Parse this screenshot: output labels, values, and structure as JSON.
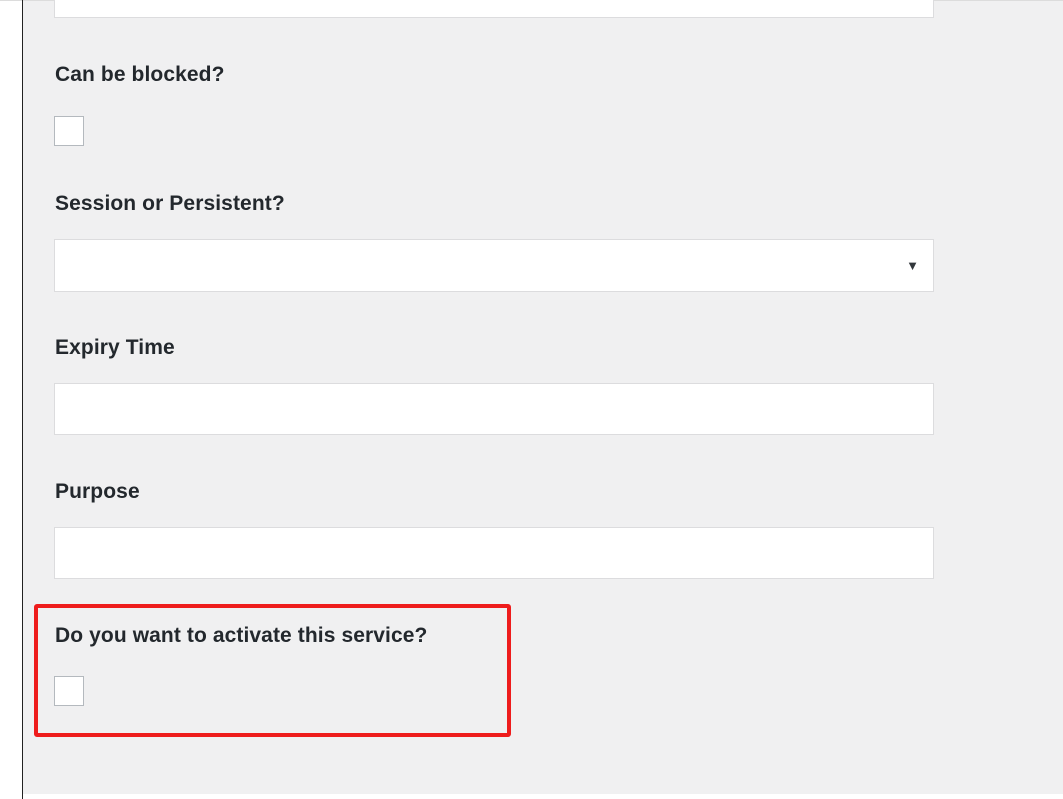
{
  "form": {
    "can_be_blocked": {
      "label": "Can be blocked?",
      "checked": false
    },
    "session_or_persistent": {
      "label": "Session or Persistent?",
      "selected_value": "",
      "arrow_icon": "dropdown-arrow-icon",
      "arrow_glyph": "▼"
    },
    "expiry_time": {
      "label": "Expiry Time",
      "value": ""
    },
    "purpose": {
      "label": "Purpose",
      "value": ""
    },
    "activate_service": {
      "label": "Do you want to activate this service?",
      "checked": false
    }
  },
  "colors": {
    "panel_background": "#f0f0f1",
    "highlight_border": "#ee1c1c",
    "label_text": "#23282d"
  }
}
